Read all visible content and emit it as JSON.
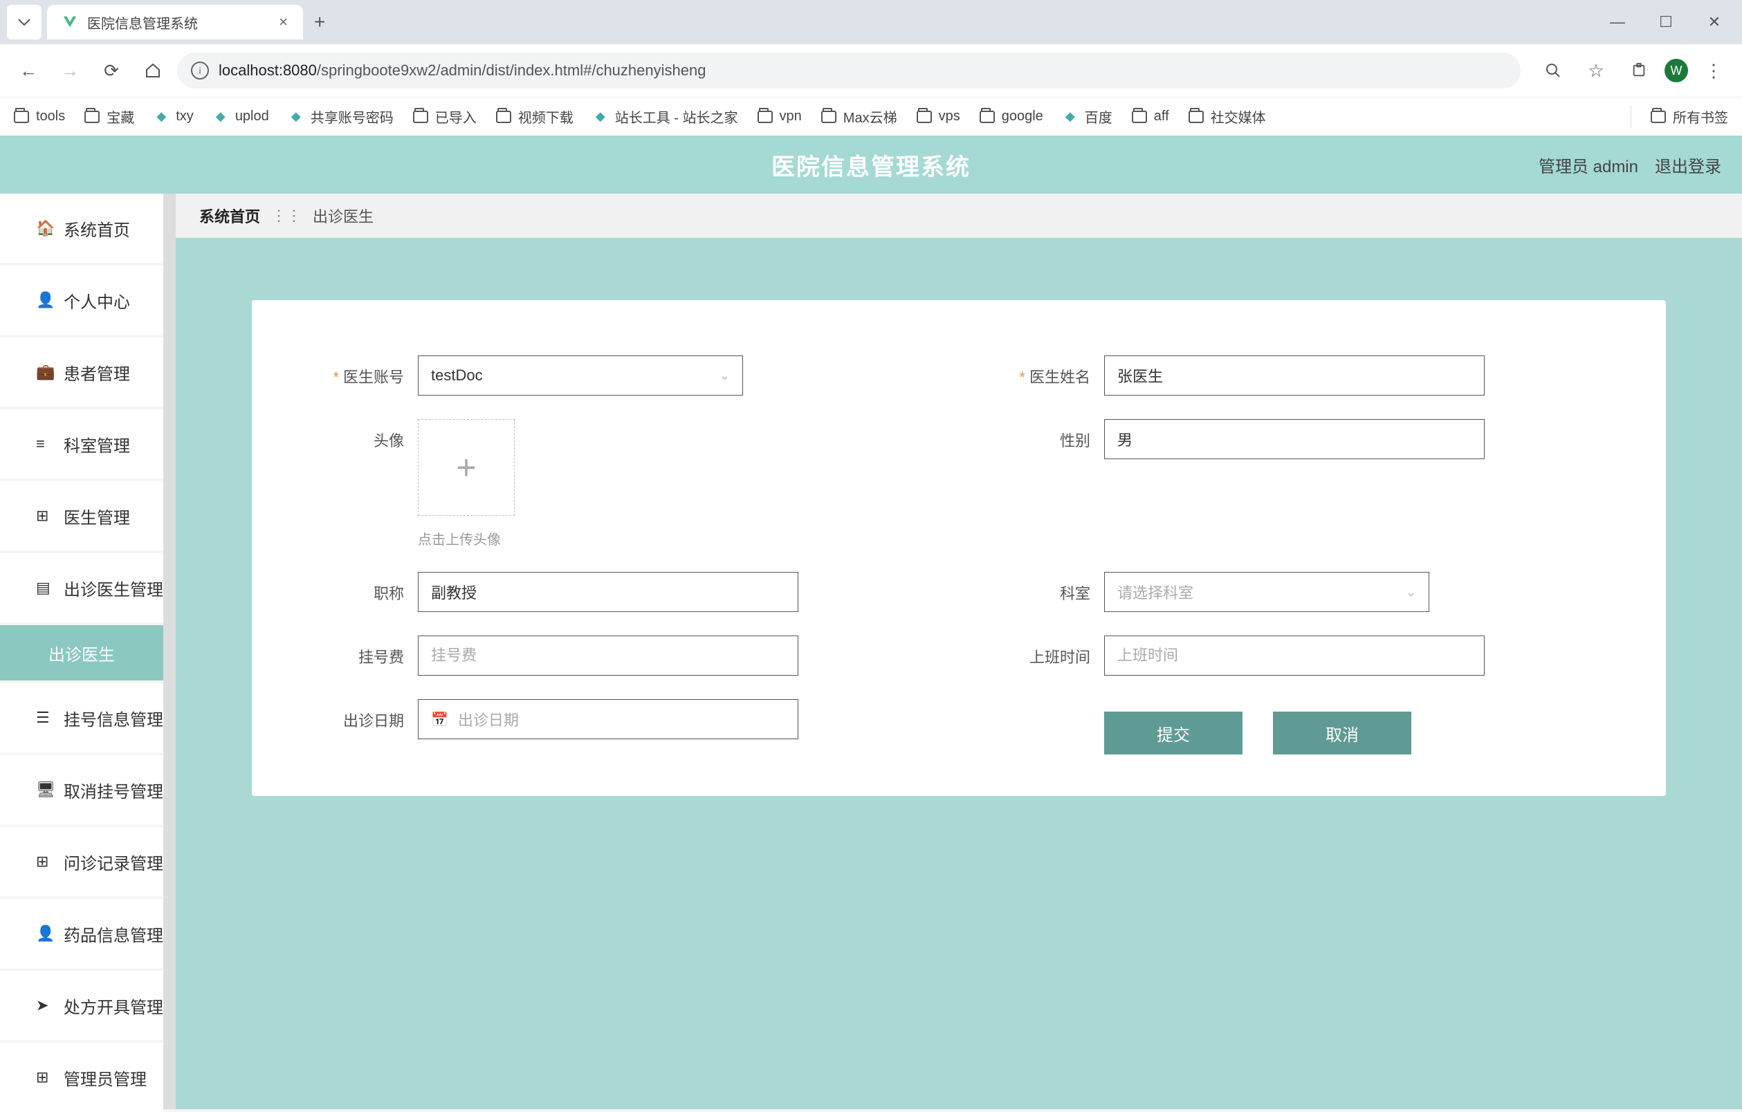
{
  "chrome": {
    "tab_title": "医院信息管理系统",
    "new_tab": "+",
    "url_host": "localhost:8080",
    "url_path": "/springboote9xw2/admin/dist/index.html#/chuzhenyisheng",
    "bookmarks": [
      {
        "type": "folder",
        "label": "tools"
      },
      {
        "type": "folder",
        "label": "宝藏"
      },
      {
        "type": "icon",
        "label": "txy"
      },
      {
        "type": "icon",
        "label": "uplod"
      },
      {
        "type": "icon",
        "label": "共享账号密码"
      },
      {
        "type": "folder",
        "label": "已导入"
      },
      {
        "type": "folder",
        "label": "视频下载"
      },
      {
        "type": "icon",
        "label": "站长工具 - 站长之家"
      },
      {
        "type": "folder",
        "label": "vpn"
      },
      {
        "type": "folder",
        "label": "Max云梯"
      },
      {
        "type": "folder",
        "label": "vps"
      },
      {
        "type": "folder",
        "label": "google"
      },
      {
        "type": "icon",
        "label": "百度"
      },
      {
        "type": "folder",
        "label": "aff"
      },
      {
        "type": "folder",
        "label": "社交媒体"
      }
    ],
    "all_bookmarks": "所有书签",
    "avatar_letter": "W"
  },
  "app": {
    "title": "医院信息管理系统",
    "user_role": "管理员 admin",
    "logout": "退出登录"
  },
  "sidebar": {
    "items": [
      {
        "icon": "home",
        "label": "系统首页"
      },
      {
        "icon": "person",
        "label": "个人中心"
      },
      {
        "icon": "briefcase",
        "label": "患者管理"
      },
      {
        "icon": "list",
        "label": "科室管理"
      },
      {
        "icon": "grid",
        "label": "医生管理"
      },
      {
        "icon": "doc",
        "label": "出诊医生管理"
      },
      {
        "icon": "",
        "label": "出诊医生",
        "sub": true
      },
      {
        "icon": "menu",
        "label": "挂号信息管理"
      },
      {
        "icon": "monitor",
        "label": "取消挂号管理"
      },
      {
        "icon": "grid2",
        "label": "问诊记录管理"
      },
      {
        "icon": "person2",
        "label": "药品信息管理"
      },
      {
        "icon": "send",
        "label": "处方开具管理"
      },
      {
        "icon": "grid3",
        "label": "管理员管理"
      }
    ]
  },
  "breadcrumb": {
    "home": "系统首页",
    "current": "出诊医生"
  },
  "form": {
    "doctor_account_label": "医生账号",
    "doctor_account_value": "testDoc",
    "doctor_name_label": "医生姓名",
    "doctor_name_value": "张医生",
    "avatar_label": "头像",
    "avatar_hint": "点击上传头像",
    "gender_label": "性别",
    "gender_value": "男",
    "title_label": "职称",
    "title_value": "副教授",
    "department_label": "科室",
    "department_placeholder": "请选择科室",
    "fee_label": "挂号费",
    "fee_placeholder": "挂号费",
    "worktime_label": "上班时间",
    "worktime_placeholder": "上班时间",
    "date_label": "出诊日期",
    "date_placeholder": "出诊日期",
    "submit": "提交",
    "cancel": "取消"
  }
}
